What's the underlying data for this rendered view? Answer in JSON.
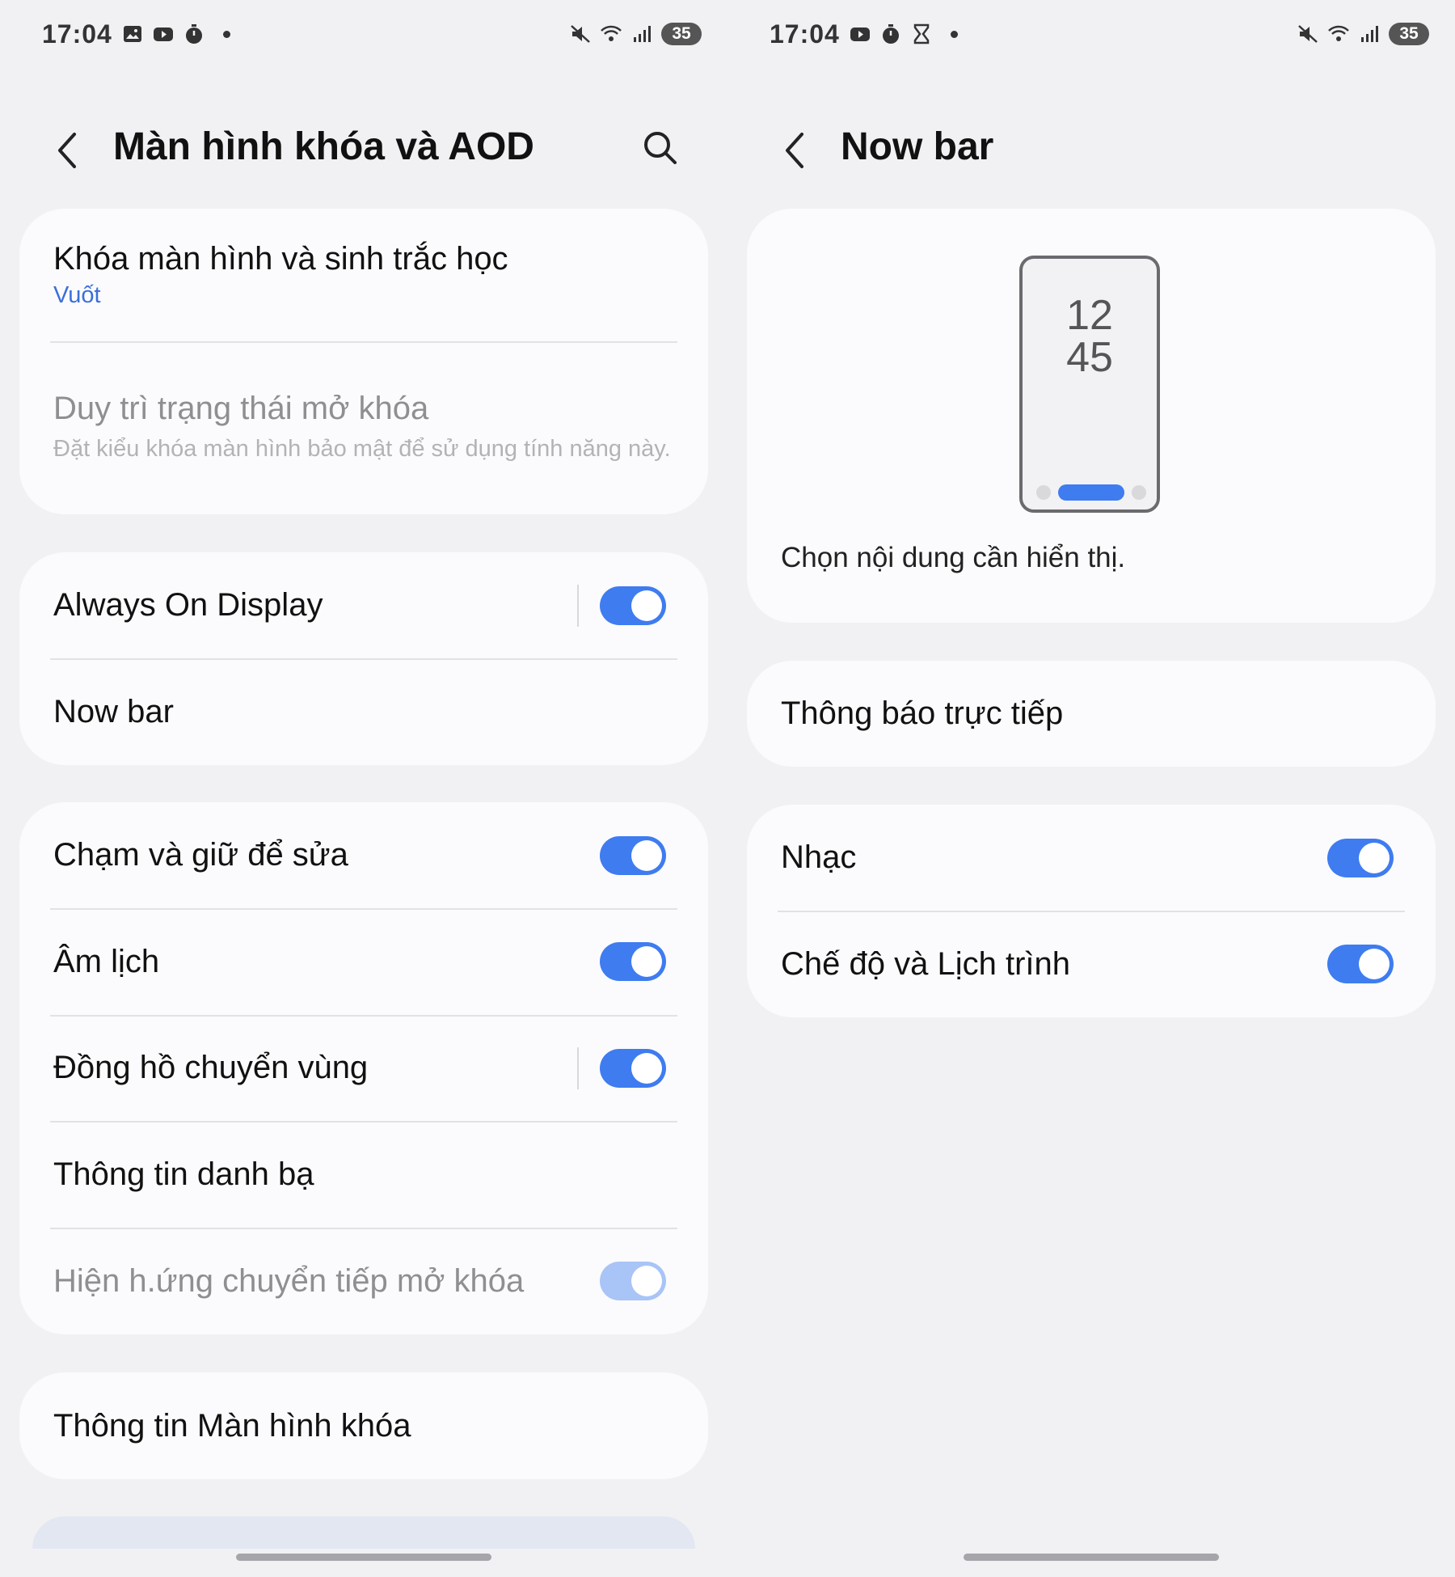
{
  "colors": {
    "accent": "#3e7cf0",
    "link": "#3b6fd9",
    "background": "#f1f1f4",
    "card": "#fbfbfd"
  },
  "left": {
    "status": {
      "time": "17:04",
      "battery": "35"
    },
    "header": {
      "title": "Màn hình khóa và AOD"
    },
    "card1": {
      "lock_title": "Khóa màn hình và sinh trắc học",
      "lock_sub": "Vuốt",
      "keep_title": "Duy trì trạng thái mở khóa",
      "keep_sub": "Đặt kiểu khóa màn hình bảo mật để sử dụng tính năng này."
    },
    "card2": {
      "aod": "Always On Display",
      "aod_on": true,
      "nowbar": "Now bar"
    },
    "card3": {
      "touch_edit": "Chạm và giữ để sửa",
      "touch_edit_on": true,
      "lunar": "Âm lịch",
      "lunar_on": true,
      "roaming_clock": "Đồng hồ chuyển vùng",
      "roaming_clock_on": true,
      "contact_info": "Thông tin danh bạ",
      "unlock_transition": "Hiện h.ứng chuyển tiếp mở khóa",
      "unlock_transition_on": true
    },
    "card4": {
      "lock_info": "Thông tin Màn hình khóa"
    }
  },
  "right": {
    "status": {
      "time": "17:04",
      "battery": "35"
    },
    "header": {
      "title": "Now bar"
    },
    "preview": {
      "hour": "12",
      "minute": "45",
      "caption": "Chọn nội dung cần hiển thị."
    },
    "card2": {
      "live_notifications": "Thông báo trực tiếp"
    },
    "card3": {
      "music": "Nhạc",
      "music_on": true,
      "modes": "Chế độ và Lịch trình",
      "modes_on": true
    }
  }
}
